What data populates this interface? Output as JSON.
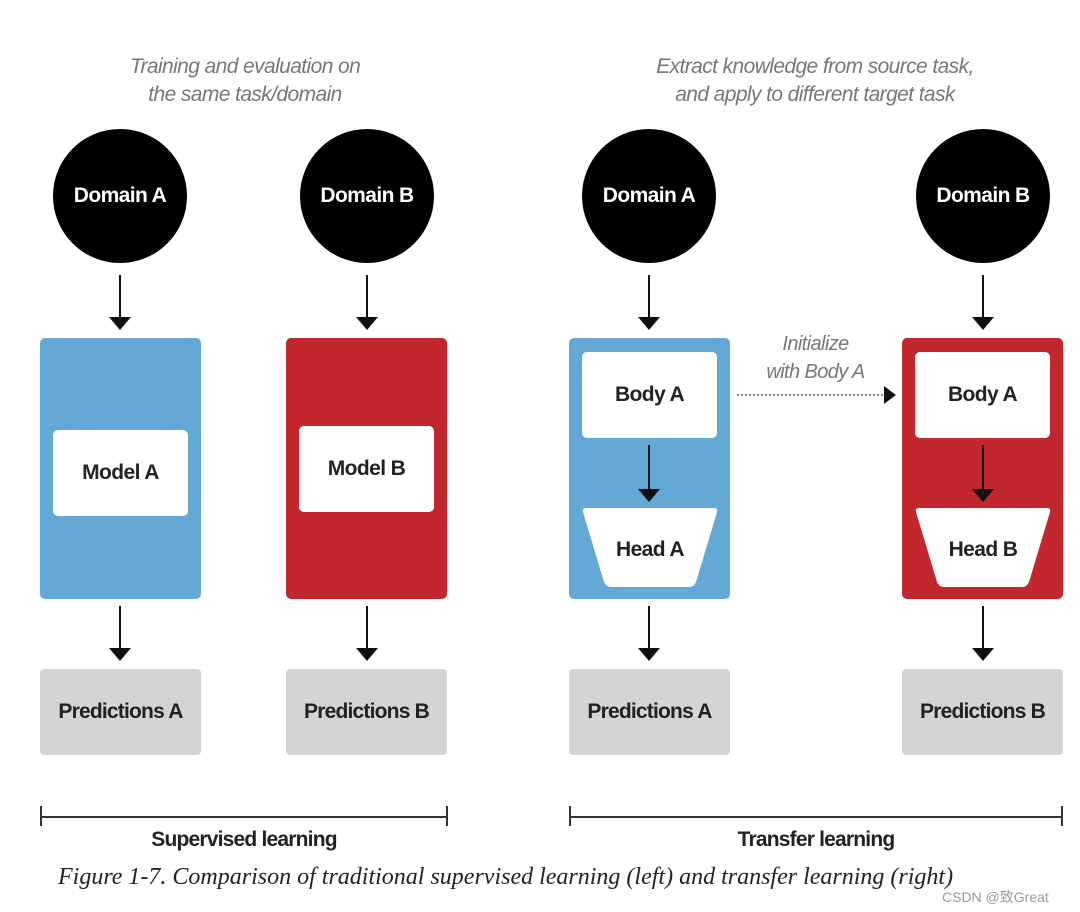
{
  "colors": {
    "source_panel": "#64a8d6",
    "target_panel": "#c1272d",
    "predictions_box": "#d4d4d4",
    "domain_node": "#000000",
    "note_text": "#777777"
  },
  "supervised": {
    "note_line1": "Training and evaluation on",
    "note_line2": "the same task/domain",
    "column_a": {
      "domain": "Domain A",
      "model": "Model A",
      "predictions": "Predictions A"
    },
    "column_b": {
      "domain": "Domain B",
      "model": "Model B",
      "predictions": "Predictions B"
    },
    "group_label": "Supervised learning"
  },
  "transfer": {
    "note_line1": "Extract knowledge from source task,",
    "note_line2": "and apply to  different target task",
    "column_a": {
      "domain": "Domain A",
      "body": "Body A",
      "head": "Head A",
      "predictions": "Predictions A"
    },
    "column_b": {
      "domain": "Domain B",
      "body": "Body A",
      "head": "Head B",
      "predictions": "Predictions B"
    },
    "init_line1": "Initialize",
    "init_line2": "with Body A",
    "group_label": "Transfer learning"
  },
  "caption": "Figure 1-7. Comparison of traditional supervised learning (left) and transfer learning (right)",
  "watermark": "CSDN @致Great"
}
